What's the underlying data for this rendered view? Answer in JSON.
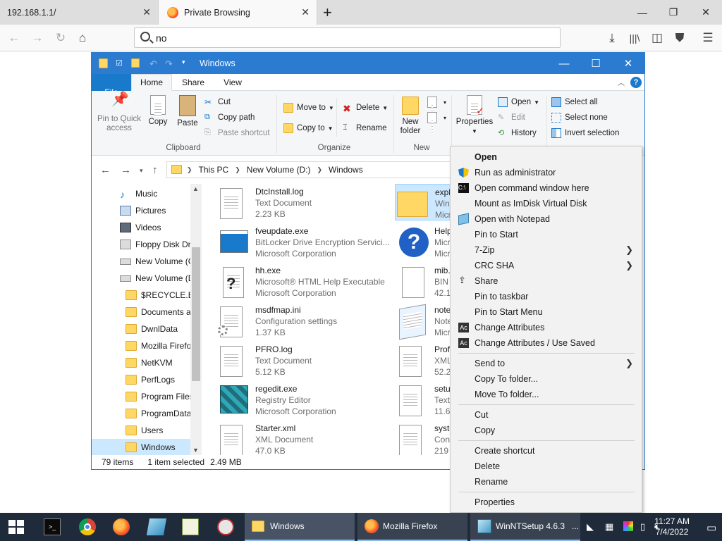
{
  "browser": {
    "tabs": [
      {
        "label": "192.168.1.1/",
        "active": false
      },
      {
        "label": "Private Browsing",
        "active": true
      }
    ],
    "url_text": "no",
    "icons": [
      "back-icon",
      "forward-icon",
      "reload-icon",
      "home-icon",
      "search-icon",
      "download-icon",
      "library-icon",
      "sidebar-icon",
      "ublock-icon",
      "menu-icon"
    ]
  },
  "explorer": {
    "title": "Windows",
    "ribbon_tabs": [
      "File",
      "Home",
      "Share",
      "View"
    ],
    "ribbon": {
      "clipboard": {
        "label": "Clipboard",
        "pin_line1": "Pin to Quick",
        "pin_line2": "access",
        "copy": "Copy",
        "paste": "Paste",
        "cut": "Cut",
        "copy_path": "Copy path",
        "paste_shortcut": "Paste shortcut"
      },
      "organize": {
        "label": "Organize",
        "move_to": "Move to",
        "copy_to": "Copy to",
        "delete": "Delete",
        "rename": "Rename"
      },
      "new": {
        "label": "New",
        "new_folder_line1": "New",
        "new_folder_line2": "folder"
      },
      "open": {
        "properties": "Properties",
        "open": "Open",
        "edit": "Edit",
        "history": "History"
      },
      "select": {
        "select_all": "Select all",
        "select_none": "Select none",
        "invert_selection": "Invert selection"
      }
    },
    "breadcrumb": [
      "This PC",
      "New Volume (D:)",
      "Windows"
    ],
    "nav_items": [
      {
        "label": "Music",
        "icon": "music-icon"
      },
      {
        "label": "Pictures",
        "icon": "pictures-icon"
      },
      {
        "label": "Videos",
        "icon": "videos-icon"
      },
      {
        "label": "Floppy Disk Dri",
        "icon": "floppy-icon"
      },
      {
        "label": "New Volume (C",
        "icon": "drive-icon"
      },
      {
        "label": "New Volume (D",
        "icon": "drive-icon"
      },
      {
        "label": "$RECYCLE.BIN",
        "icon": "folder-icon"
      },
      {
        "label": "Documents a",
        "icon": "folder-icon"
      },
      {
        "label": "DwnlData",
        "icon": "folder-icon"
      },
      {
        "label": "Mozilla Firefo",
        "icon": "folder-icon"
      },
      {
        "label": "NetKVM",
        "icon": "folder-icon"
      },
      {
        "label": "PerfLogs",
        "icon": "folder-icon"
      },
      {
        "label": "Program Files",
        "icon": "folder-icon"
      },
      {
        "label": "ProgramData",
        "icon": "folder-icon"
      },
      {
        "label": "Users",
        "icon": "folder-icon"
      },
      {
        "label": "Windows",
        "icon": "folder-icon"
      }
    ],
    "files_col1": [
      {
        "name": "DtcInstall.log",
        "line1": "Text Document",
        "line2": "2.23 KB",
        "icon": "text-file-icon"
      },
      {
        "name": "fveupdate.exe",
        "line1": "BitLocker Drive Encryption Servici...",
        "line2": "Microsoft Corporation",
        "icon": "exe-window-icon"
      },
      {
        "name": "hh.exe",
        "line1": "Microsoft® HTML Help Executable",
        "line2": "Microsoft Corporation",
        "icon": "help-exe-icon"
      },
      {
        "name": "msdfmap.ini",
        "line1": "Configuration settings",
        "line2": "1.37 KB",
        "icon": "config-file-icon"
      },
      {
        "name": "PFRO.log",
        "line1": "Text Document",
        "line2": "5.12 KB",
        "icon": "text-file-icon"
      },
      {
        "name": "regedit.exe",
        "line1": "Registry Editor",
        "line2": "Microsoft Corporation",
        "icon": "regedit-icon"
      },
      {
        "name": "Starter.xml",
        "line1": "XML Document",
        "line2": "47.0 KB",
        "icon": "xml-file-icon"
      }
    ],
    "files_col2": [
      {
        "name": "expl",
        "line1": "Win",
        "line2": "Micr",
        "icon": "explorer-exe-icon",
        "selected": true
      },
      {
        "name": "Help",
        "line1": "Micr",
        "line2": "Micr",
        "icon": "help-icon"
      },
      {
        "name": "mib.",
        "line1": "BIN",
        "line2": "42.1",
        "icon": "bin-file-icon"
      },
      {
        "name": "note",
        "line1": "Note",
        "line2": "Micr",
        "icon": "notepad-icon"
      },
      {
        "name": "Prof",
        "line1": "XML",
        "line2": "52.2",
        "icon": "xml-file-icon"
      },
      {
        "name": "setu",
        "line1": "Text",
        "line2": "11.6",
        "icon": "text-file-icon"
      },
      {
        "name": "syste",
        "line1": "Con",
        "line2": "219",
        "icon": "config-file-icon"
      }
    ],
    "status": {
      "items": "79 items",
      "selected": "1 item selected",
      "size": "2.49 MB"
    }
  },
  "context_menu": {
    "items": [
      {
        "label": "Open",
        "bold": true
      },
      {
        "label": "Run as administrator",
        "icon": "shield-icon"
      },
      {
        "label": "Open command window here",
        "icon": "cmd-icon"
      },
      {
        "label": "Mount as ImDisk Virtual Disk"
      },
      {
        "label": "Open with Notepad",
        "icon": "notepad-icon"
      },
      {
        "label": "Pin to Start"
      },
      {
        "label": "7-Zip",
        "submenu": true
      },
      {
        "label": "CRC SHA",
        "submenu": true
      },
      {
        "label": "Share",
        "icon": "share-icon"
      },
      {
        "label": "Pin to taskbar"
      },
      {
        "label": "Pin to Start Menu"
      },
      {
        "label": "Change Attributes",
        "icon": "attributes-icon"
      },
      {
        "label": "Change Attributes / Use Saved",
        "icon": "attributes-icon"
      },
      {
        "label": "Send to",
        "submenu": true
      },
      {
        "label": "Copy To folder..."
      },
      {
        "label": "Move To folder..."
      },
      {
        "label": "Cut"
      },
      {
        "label": "Copy"
      },
      {
        "label": "Create shortcut"
      },
      {
        "label": "Delete"
      },
      {
        "label": "Rename"
      },
      {
        "label": "Properties"
      }
    ]
  },
  "taskbar": {
    "tasks": [
      {
        "label": "Windows",
        "icon": "folder-icon"
      },
      {
        "label": "Mozilla Firefox",
        "icon": "firefox-icon"
      },
      {
        "label": "WinNTSetup 4.6.3",
        "icon": "winntsetup-icon"
      }
    ],
    "more_label": "...",
    "time": "11:27 AM",
    "date": "7/4/2022"
  },
  "colors": {
    "explorer_title": "#2b7bd0",
    "ribbon_file_tab": "#1979ca",
    "selection": "#cce8ff",
    "taskbar": "#1f2b3b",
    "folder": "#ffd765"
  }
}
